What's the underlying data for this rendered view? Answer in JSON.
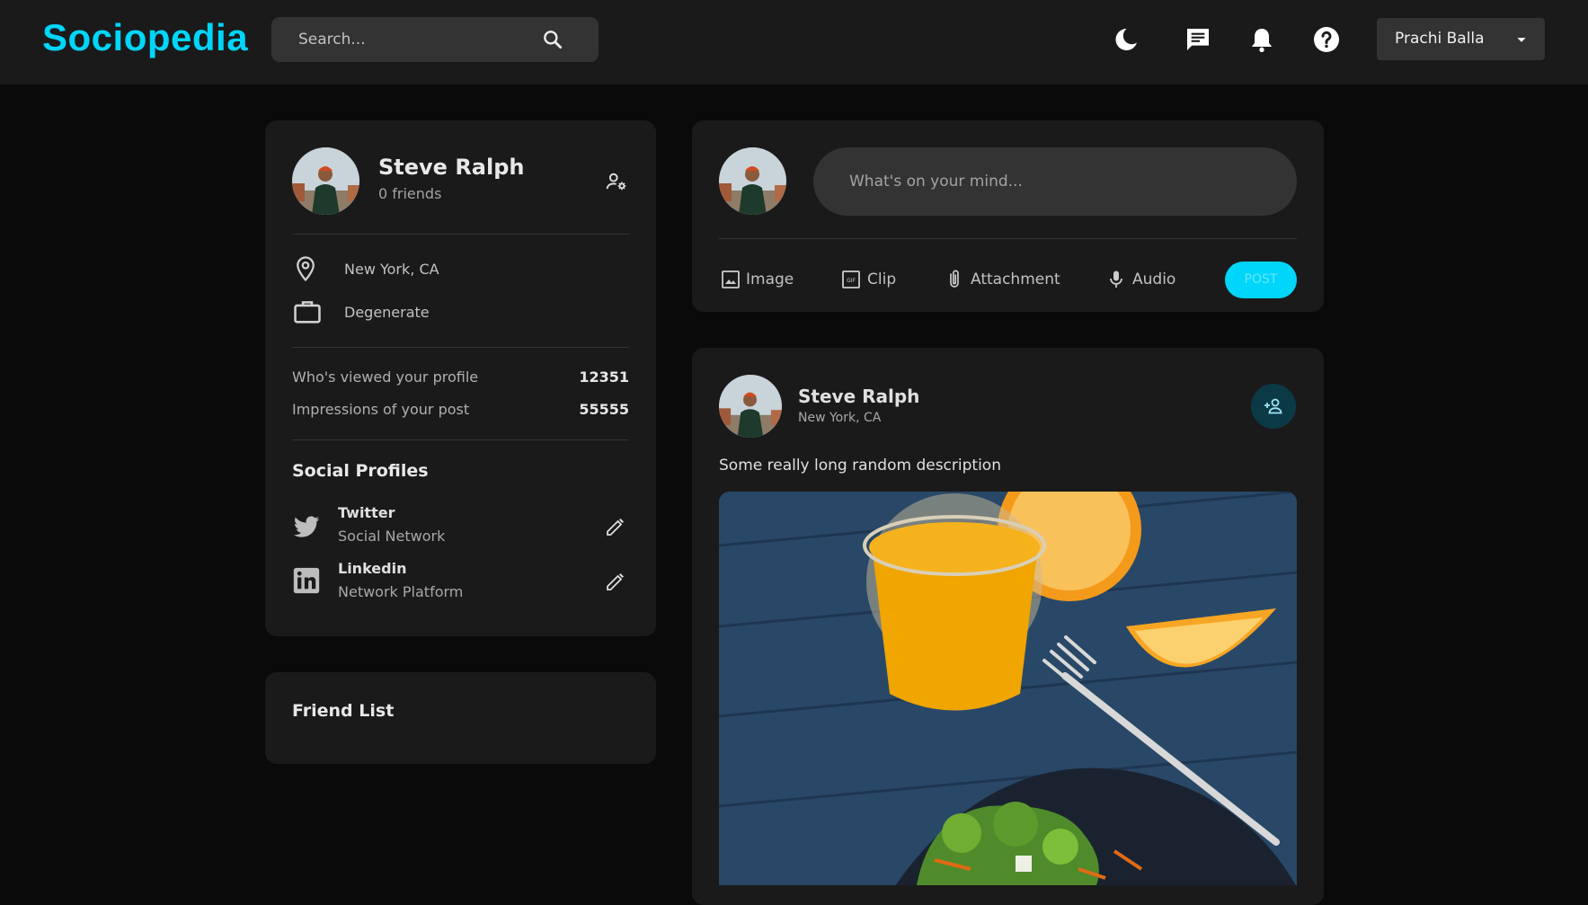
{
  "app": {
    "logo": "Sociopedia"
  },
  "navbar": {
    "search_placeholder": "Search...",
    "icons": [
      "search-icon",
      "dark-mode-icon",
      "message-icon",
      "notifications-icon",
      "help-icon"
    ],
    "user_name": "Prachi Balla"
  },
  "colors": {
    "accent": "#00d5fa",
    "card": "#1a1a1a",
    "background": "#0a0a0a",
    "input": "#333333"
  },
  "profile_widget": {
    "name": "Steve Ralph",
    "friends": "0 friends",
    "location": "New York, CA",
    "occupation": "Degenerate",
    "stats": [
      {
        "label": "Who's viewed your profile",
        "value": "12351"
      },
      {
        "label": "Impressions of your post",
        "value": "55555"
      }
    ],
    "social_title": "Social Profiles",
    "socials": [
      {
        "name": "Twitter",
        "type": "Social Network",
        "icon": "twitter-icon"
      },
      {
        "name": "Linkedin",
        "type": "Network Platform",
        "icon": "linkedin-icon"
      }
    ]
  },
  "friend_list": {
    "title": "Friend List"
  },
  "create_post": {
    "placeholder": "What's on your mind...",
    "actions": [
      {
        "label": "Image",
        "icon": "image-icon"
      },
      {
        "label": "Clip",
        "icon": "gif-icon"
      },
      {
        "label": "Attachment",
        "icon": "attachment-icon"
      },
      {
        "label": "Audio",
        "icon": "microphone-icon"
      }
    ],
    "post_label": "POST"
  },
  "post": {
    "author": "Steve Ralph",
    "location": "New York, CA",
    "description": "Some really long random description",
    "image_alt": "orange juice, orange slices, fork and salad"
  }
}
